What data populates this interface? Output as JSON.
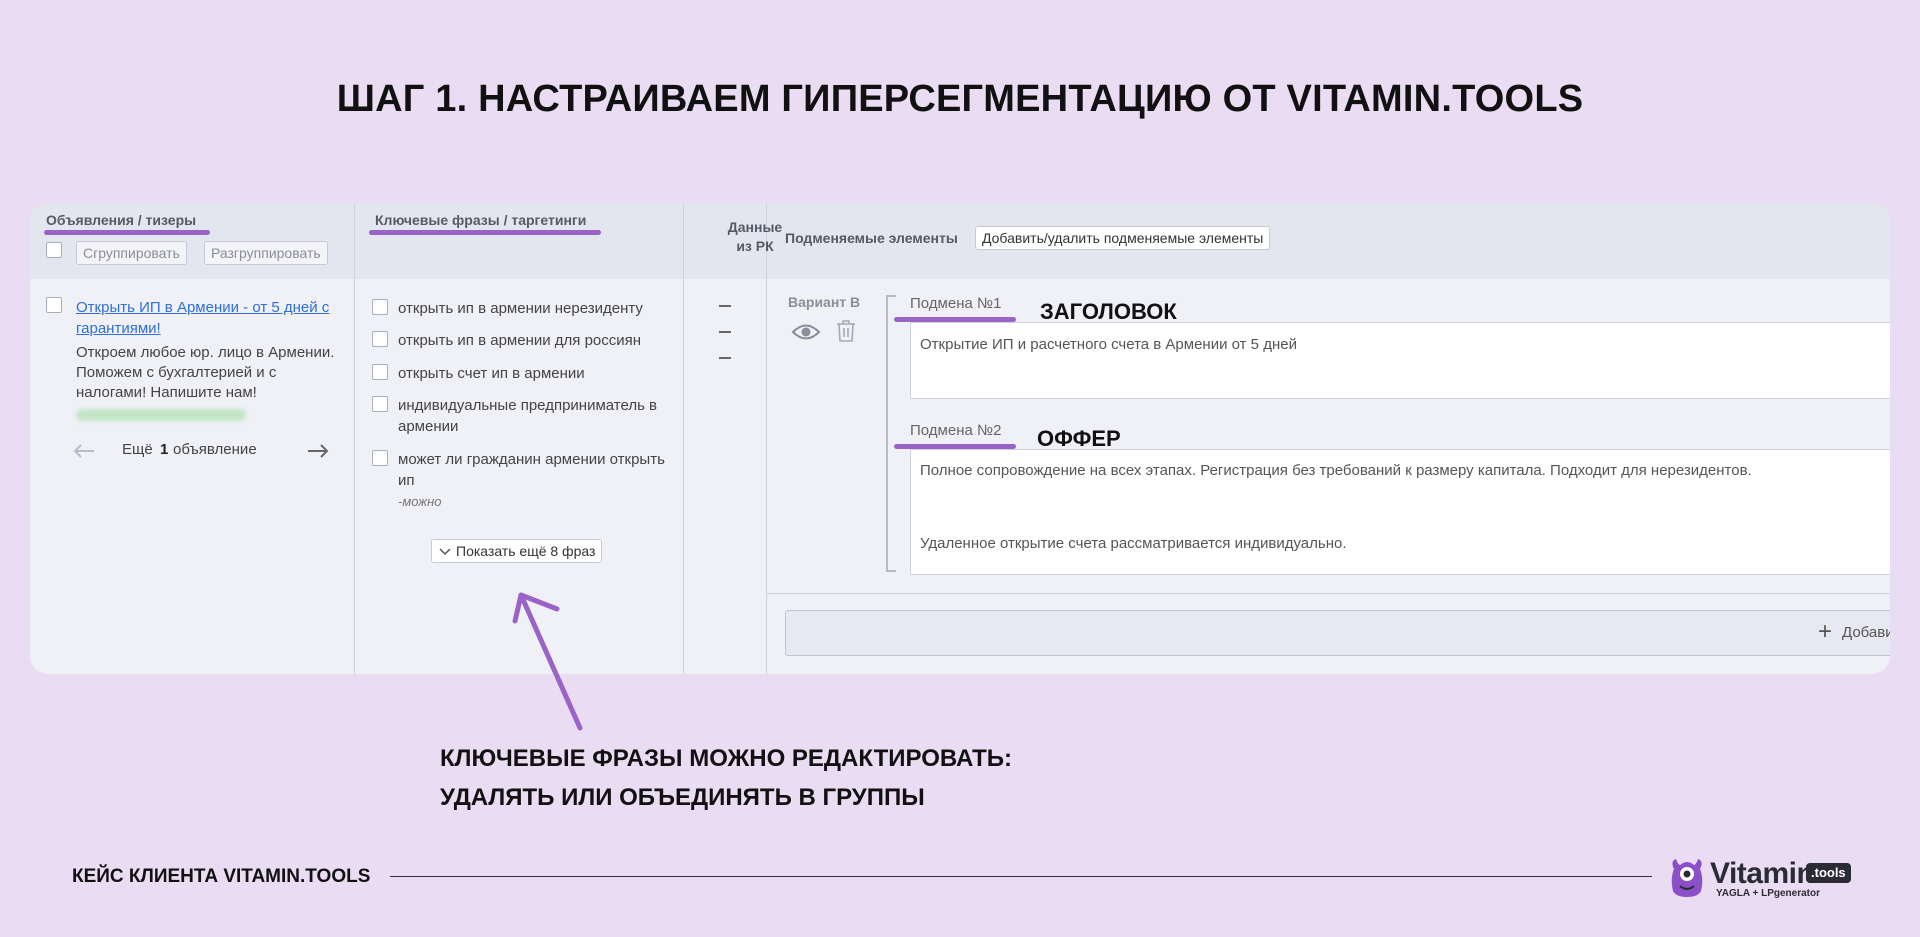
{
  "slide": {
    "title": "ШАГ 1. НАСТРАИВАЕМ ГИПЕРСЕГМЕНТАЦИЮ ОТ VITAMIN.TOOLS",
    "caption_line1": "КЛЮЧЕВЫЕ ФРАЗЫ МОЖНО РЕДАКТИРОВАТЬ:",
    "caption_line2": "УДАЛЯТЬ ИЛИ ОБЪЕДИНЯТЬ В ГРУППЫ",
    "footer": "КЕЙС КЛИЕНТА VITAMIN.TOOLS",
    "accent_color": "#9a63c8"
  },
  "ads": {
    "title": "Объявления / тизеры",
    "group_btn": "Сгруппировать",
    "ungroup_btn": "Разгруппировать",
    "ad_title": "Открыть ИП в Армении - от 5 дней с гарантиями!",
    "ad_text": "Откроем любое юр. лицо в Армении. Поможем с бухгалтерией и с налогами! Напишите нам!",
    "more_prefix": "Ещё",
    "more_count": "1",
    "more_suffix": "объявление"
  },
  "keywords": {
    "title": "Ключевые фразы / таргетинги",
    "items": [
      "открыть ип в армении нерезиденту",
      "открыть ип в армении для россиян",
      "открыть счет ип в армении",
      "индивидуальные предприниматель в армении",
      "может ли гражданин армении открыть ип"
    ],
    "note": "-можно",
    "show_more": "Показать ещё 8 фраз"
  },
  "data_col": {
    "title_line1": "Данные",
    "title_line2": "из РК",
    "values": [
      "–",
      "–",
      "–"
    ]
  },
  "replace": {
    "title": "Подменяемые элементы",
    "edit_btn": "Добавить/удалить подменяемые элементы",
    "variant": "Вариант В",
    "sub1_label": "Подмена №1",
    "sub1_annotation": "ЗАГОЛОВОК",
    "sub1_text": "Открытие ИП и расчетного счета в Армении от 5 дней",
    "sub2_label": "Подмена №2",
    "sub2_annotation": "ОФФЕР",
    "sub2_text1": "Полное сопровождение на всех этапах. Регистрация без требований к размеру капитала. Подходит для нерезидентов.",
    "sub2_text2": "Удаленное открытие счета рассматривается индивидуально.",
    "add_label": "Добавить в"
  },
  "logo": {
    "word": "Vitamin",
    "badge": ".tools",
    "sub": "YAGLA + LPgenerator"
  },
  "icons": [
    "eye-icon",
    "trash-icon",
    "arrow-left-icon",
    "arrow-right-icon",
    "chevron-down-icon",
    "plus-icon"
  ]
}
